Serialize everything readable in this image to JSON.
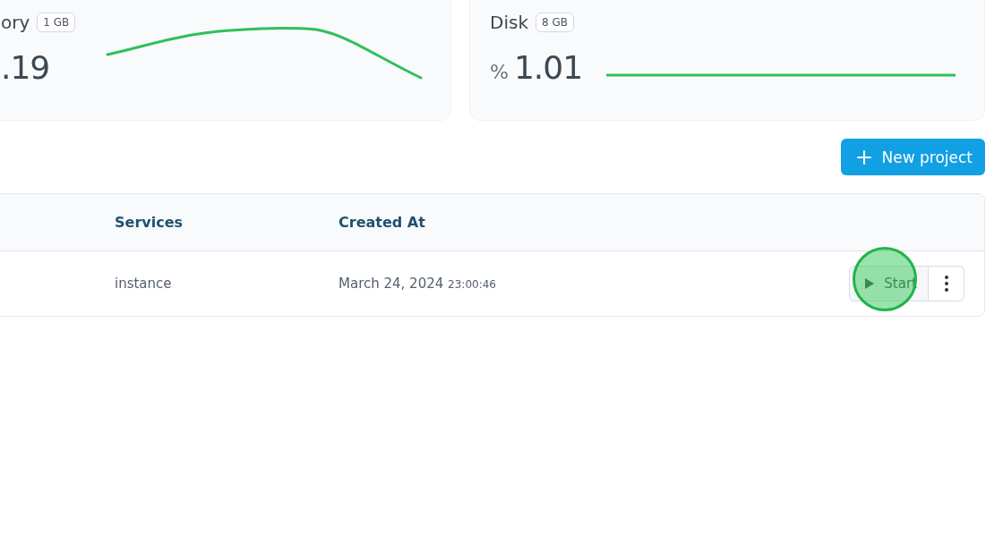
{
  "stats": [
    {
      "kind": "memory",
      "label": "ory",
      "badge": "1 GB",
      "value": ".19"
    },
    {
      "kind": "disk",
      "label": "Disk",
      "badge": "8 GB",
      "unit": "%",
      "value": "1.01"
    }
  ],
  "new_project_button": {
    "label": "New project"
  },
  "table": {
    "columns": [
      "Services",
      "Created At"
    ],
    "rows": [
      {
        "services": "instance",
        "date": "March 24, 2024",
        "time": "23:00:46",
        "actions": {
          "start": "Start"
        }
      }
    ]
  }
}
